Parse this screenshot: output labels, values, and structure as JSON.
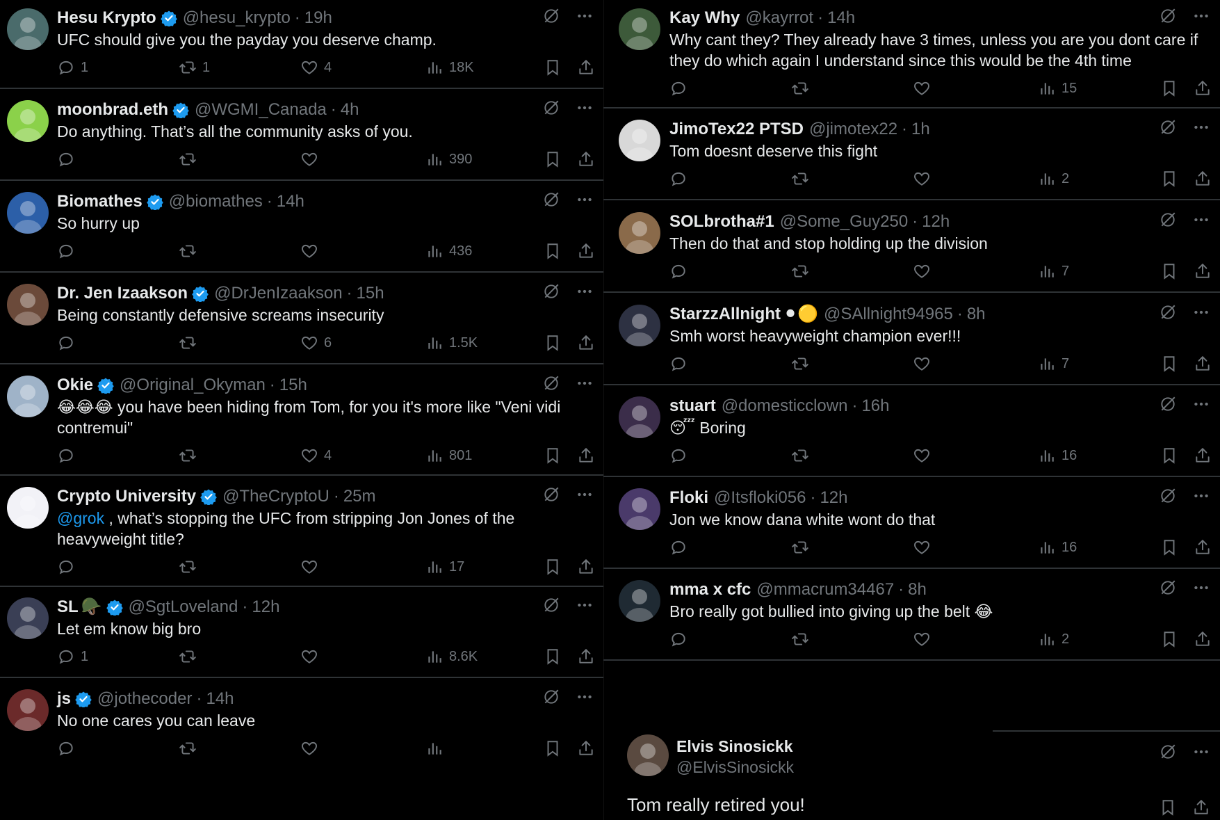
{
  "left_column": [
    {
      "name": "Hesu Krypto",
      "verified": true,
      "handle": "@hesu_krypto",
      "time": "19h",
      "text": "UFC should give you the payday you deserve champ.",
      "replies": "1",
      "reposts": "1",
      "likes": "4",
      "views": "18K",
      "avatar_color": "#4a6b6b"
    },
    {
      "name": "moonbrad.eth",
      "verified": true,
      "handle": "@WGMI_Canada",
      "time": "4h",
      "text": "Do anything. That’s all the community asks of you.",
      "replies": "",
      "reposts": "",
      "likes": "",
      "views": "390",
      "avatar_color": "#8bd14a"
    },
    {
      "name": "Biomathes",
      "verified": true,
      "handle": "@biomathes",
      "time": "14h",
      "text": "So hurry up",
      "replies": "",
      "reposts": "",
      "likes": "",
      "views": "436",
      "avatar_color": "#2c5fa8"
    },
    {
      "name": "Dr. Jen Izaakson",
      "verified": true,
      "handle": "@DrJenIzaakson",
      "time": "15h",
      "text": "Being constantly defensive screams insecurity",
      "replies": "",
      "reposts": "",
      "likes": "6",
      "views": "1.5K",
      "avatar_color": "#6b4a3a"
    },
    {
      "name": "Okie",
      "verified": true,
      "handle": "@Original_Okyman",
      "time": "15h",
      "text_emoji": "😂😂😂",
      "text": " you have been hiding from Tom, for you it's more like \"Veni vidi contremui\"",
      "replies": "",
      "reposts": "",
      "likes": "4",
      "views": "801",
      "avatar_color": "#9fb3c8"
    },
    {
      "name": "Crypto University",
      "verified": true,
      "handle": "@TheCryptoU",
      "time": "25m",
      "mention": "@grok",
      "text": " , what’s stopping the UFC from stripping Jon Jones of the heavyweight title?",
      "replies": "",
      "reposts": "",
      "likes": "",
      "views": "17",
      "avatar_color": "#f2f2f7"
    },
    {
      "name": "SL",
      "name_emoji": "🪖",
      "verified": true,
      "handle": "@SgtLoveland",
      "time": "12h",
      "text": "Let em know big bro",
      "replies": "1",
      "reposts": "",
      "likes": "",
      "views": "8.6K",
      "avatar_color": "#3a3f55"
    },
    {
      "name": "js",
      "verified": true,
      "handle": "@jothecoder",
      "time": "14h",
      "text": "No one cares you can leave",
      "replies": "",
      "reposts": "",
      "likes": "",
      "views": "",
      "avatar_color": "#6b2a2a"
    }
  ],
  "right_column": [
    {
      "name": "Kay Why",
      "verified": false,
      "handle": "@kayrrot",
      "time": "14h",
      "text": "Why cant they? They already have 3 times, unless you are you dont care if they do which again I understand since this would be the 4th time",
      "views": "15",
      "avatar_color": "#3d5a3a"
    },
    {
      "name": "JimoTex22 PTSD",
      "verified": false,
      "handle": "@jimotex22",
      "time": "1h",
      "text": "Tom doesnt deserve this fight",
      "views": "2",
      "avatar_color": "#d8d8d8"
    },
    {
      "name": "SOLbrotha#1",
      "verified": false,
      "handle": "@Some_Guy250",
      "time": "12h",
      "text": "Then do that and stop holding up the division",
      "views": "7",
      "avatar_color": "#8a6a4a"
    },
    {
      "name": "StarzzAllnight",
      "name_emoji": "⚫🟡",
      "verified": false,
      "handle": "@SAllnight94965",
      "time": "8h",
      "text": "Smh worst heavyweight champion ever!!!",
      "views": "7",
      "avatar_color": "#2d3142"
    },
    {
      "name": "stuart",
      "verified": false,
      "handle": "@domesticclown",
      "time": "16h",
      "text_emoji": "😴",
      "text": " Boring",
      "views": "16",
      "avatar_color": "#3b2d4a"
    },
    {
      "name": "Floki",
      "verified": false,
      "handle": "@Itsfloki056",
      "time": "12h",
      "text": "Jon we know dana white wont do that",
      "views": "16",
      "avatar_color": "#4a3a6a"
    },
    {
      "name": "mma x cfc",
      "verified": false,
      "handle": "@mmacrum34467",
      "time": "8h",
      "text": "Bro really got bullied into giving up the belt 😂",
      "views": "2",
      "avatar_color": "#1f2a33"
    }
  ],
  "expanded_tweet": {
    "name": "Elvis Sinosickk",
    "handle": "@ElvisSinosickk",
    "text": "Tom really retired you!",
    "avatar_color": "#5a4a40"
  },
  "colors": {
    "background": "#000000",
    "text": "#e7e9ea",
    "muted": "#71767b",
    "accent": "#1d9bf0",
    "separator": "#2f3336"
  },
  "icons": [
    "reply-icon",
    "repost-icon",
    "like-icon",
    "views-icon",
    "bookmark-icon",
    "share-icon",
    "grok-icon",
    "more-icon",
    "verified-badge-icon"
  ]
}
